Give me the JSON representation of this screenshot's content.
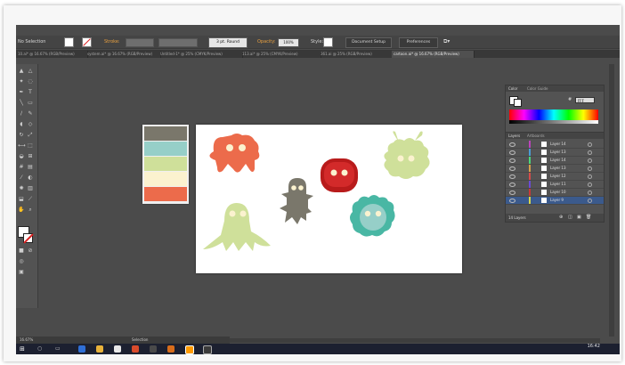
{
  "control": {
    "selection_label": "No Selection",
    "stroke_label": "Stroke:",
    "stroke_weight": "",
    "brush_label": "3 pt. Round",
    "opacity_label": "Opacity:",
    "opacity_value": "100%",
    "style_label": "Style:",
    "doc_setup_label": "Document Setup",
    "preferences_label": "Preferences"
  },
  "tabs": [
    {
      "label": "10.ai* @ 16.67% (RGB/Preview)",
      "active": false
    },
    {
      "label": "system.ai* @ 16.67% (RGB/Preview)",
      "active": false
    },
    {
      "label": "Untitled-1* @ 25% (CMYK/Preview)",
      "active": false
    },
    {
      "label": "113.ai* @ 25% (CMYK/Preview)",
      "active": false
    },
    {
      "label": "361.ai @ 25% (RGB/Preview)",
      "active": false
    },
    {
      "label": "cartoon.ai* @ 16.67% (RGB/Preview)",
      "active": true
    }
  ],
  "palette": [
    "#7a776b",
    "#96cfc8",
    "#cfe09a",
    "#fbf2cf",
    "#ec6b4b"
  ],
  "colors": {
    "orange": "#ec6b4b",
    "green": "#cfe09a",
    "gray": "#7a776b",
    "red": "#b81b1b",
    "teal": "#49b7a4",
    "teal_inner": "#96cfc8",
    "eye": "#fbf2cf"
  },
  "color_panel": {
    "tab_color": "Color",
    "tab_guide": "Color Guide",
    "hex": "FFF"
  },
  "layers_panel": {
    "tab_layers": "Layers",
    "tab_artboards": "Artboards",
    "footer": "14 Layers",
    "rows": [
      {
        "name": "Layer 14",
        "color": "#bb44bb",
        "selected": false
      },
      {
        "name": "Layer 13",
        "color": "#4b9bd6",
        "selected": false
      },
      {
        "name": "Layer 14",
        "color": "#4bd67a",
        "selected": false
      },
      {
        "name": "Layer 13",
        "color": "#d6a04b",
        "selected": false
      },
      {
        "name": "Layer 12",
        "color": "#d64b4b",
        "selected": false
      },
      {
        "name": "Layer 11",
        "color": "#6b4bd6",
        "selected": false
      },
      {
        "name": "Layer 10",
        "color": "#c93838",
        "selected": false
      },
      {
        "name": "Layer 9",
        "color": "#d6d64b",
        "selected": true
      }
    ]
  },
  "status": {
    "zoom": "16.67%",
    "tool": "Selection"
  },
  "clock": {
    "time": "16:42",
    "date": ""
  }
}
